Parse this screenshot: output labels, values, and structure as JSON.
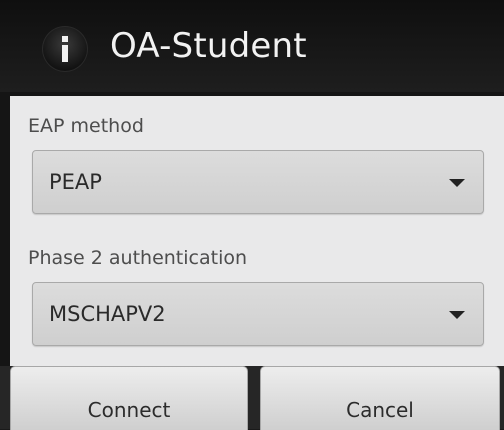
{
  "dialog": {
    "title": "OA-Student",
    "icon": "info-icon"
  },
  "fields": {
    "eap": {
      "label": "EAP method",
      "value": "PEAP"
    },
    "phase2": {
      "label": "Phase 2 authentication",
      "value": "MSCHAPV2"
    }
  },
  "buttons": {
    "connect": "Connect",
    "cancel": "Cancel"
  }
}
